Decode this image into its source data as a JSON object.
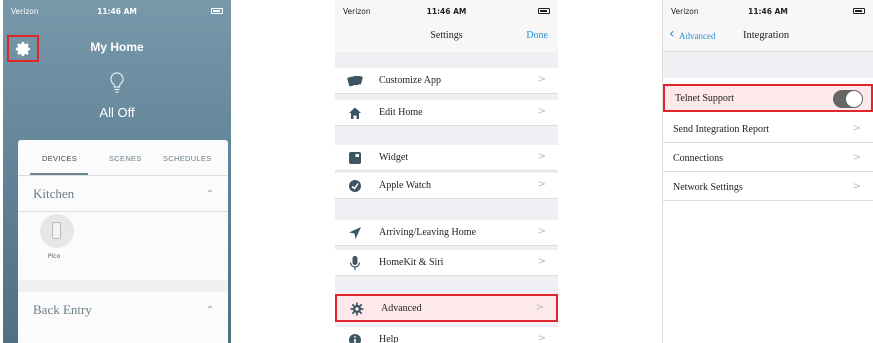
{
  "phone1": {
    "status": {
      "carrier": "Verizon",
      "time": "11:46 AM"
    },
    "title": "My Home",
    "main_status": "All Off",
    "tabs": [
      "DEVICES",
      "SCENES",
      "SCHEDULES"
    ],
    "rooms": [
      "Kitchen",
      "Back Entry"
    ],
    "device_label": "Pico",
    "icons": {
      "settings": "gear-icon",
      "light": "lightbulb-icon"
    }
  },
  "phone2": {
    "status": {
      "carrier": "Verizon",
      "time": "11:46 AM"
    },
    "title": "Settings",
    "done_label": "Done",
    "rows": [
      {
        "label": "Customize App",
        "icon": "cards-icon"
      },
      {
        "label": "Edit Home",
        "icon": "house-icon"
      },
      {
        "label": "Widget",
        "icon": "widget-icon"
      },
      {
        "label": "Apple Watch",
        "icon": "watch-icon"
      },
      {
        "label": "Arriving/Leaving Home",
        "icon": "location-arrow-icon"
      },
      {
        "label": "HomeKit & Siri",
        "icon": "microphone-icon"
      },
      {
        "label": "Advanced",
        "icon": "gear-icon"
      },
      {
        "label": "Help",
        "icon": "info-icon"
      }
    ]
  },
  "phone3": {
    "status": {
      "carrier": "Verizon",
      "time": "11:46 AM"
    },
    "back_label": "Advanced",
    "title": "Integration",
    "rows": [
      {
        "label": "Telnet Support"
      },
      {
        "label": "Send Integration Report"
      },
      {
        "label": "Connections"
      },
      {
        "label": "Network Settings"
      }
    ],
    "telnet_enabled": true
  },
  "colors": {
    "highlight": "#e0262a",
    "accent": "#2a8ed0",
    "home_bg": "#6b8c9e"
  }
}
